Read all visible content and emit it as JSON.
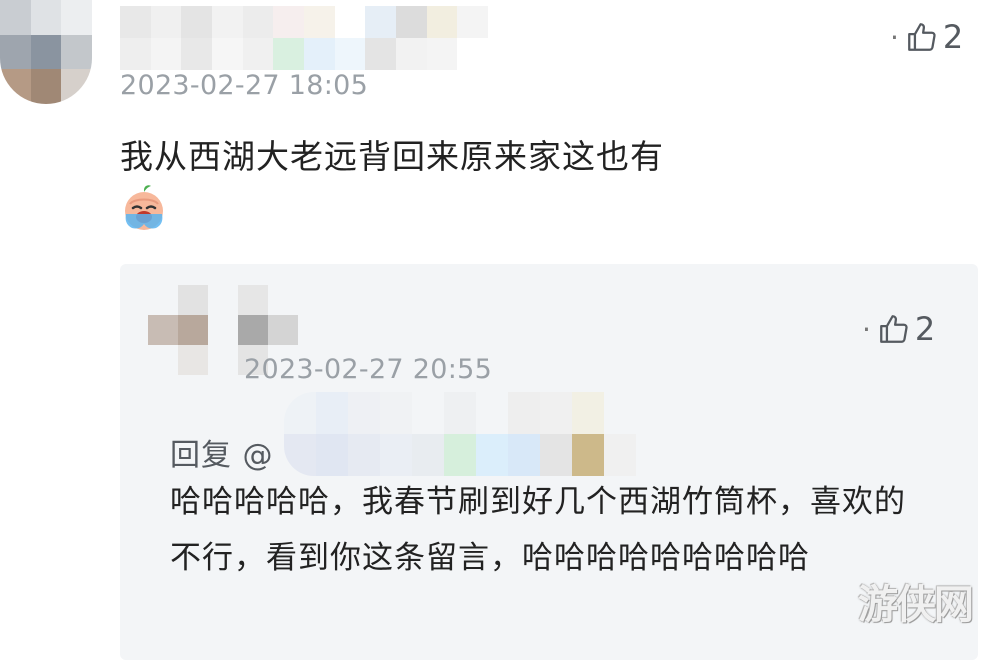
{
  "comment": {
    "timestamp": "2023-02-27 18:05",
    "text": "我从西湖大老远背回来原来家这也有",
    "emoji_icon": "crying-face-emoji-icon",
    "like_count": "2",
    "avatar_colors": [
      "#c9cdd2",
      "#dfe2e5",
      "#eceef0",
      "#9ea5ae",
      "#8a94a0",
      "#c3c7cb",
      "#b59a85",
      "#a08875",
      "#d6d0cb"
    ],
    "name_colors": [
      "#e8e8e8",
      "#f0f0f0",
      "#e4e4e4",
      "#f2f2f2",
      "#ececec",
      "#f6eeee",
      "#f6f2ea",
      "#ffffff",
      "#e6eef6",
      "#dcdcdc",
      "#f2eee0",
      "#f4f4f4",
      "#eeeeee",
      "#f4f4f4",
      "#e8e8e8",
      "#f6f6f6",
      "#f0f0f0",
      "#d9f0e0",
      "#e4f0fa",
      "#eef6fc",
      "#e4e4e4",
      "#f2f2f2",
      "#f4f4f4",
      "#ffffff"
    ]
  },
  "reply": {
    "timestamp": "2023-02-27 20:55",
    "reply_label": "回复 @",
    "text": "哈哈哈哈哈，我春节刷到好几个西湖竹筒杯，喜欢的不行，看到你这条留言，哈哈哈哈哈哈哈哈哈",
    "like_count": "2",
    "avatar_colors": [
      "#f3f5f7",
      "#e2e2e2",
      "#f3f5f7",
      "#e6e6e6",
      "#f3f5f7",
      "#c8bcb4",
      "#b8a89c",
      "#f3f5f7",
      "#a9a9a9",
      "#d4d4d4",
      "#f3f5f7",
      "#e8e6e4",
      "#f3f5f7",
      "#e4e4e4",
      "#f3f5f7"
    ],
    "name_colors": [
      "#eef2f6",
      "#e8eef6",
      "#eef0f4",
      "#f0f2f4",
      "#f3f5f7",
      "#eef0f2",
      "#f3f5f7",
      "#eeeeee",
      "#f0f0f0",
      "#f2f0e4",
      "#f3f5f7",
      "#e4e8f2",
      "#e0e6f2",
      "#e6eaf2",
      "#eaeef4",
      "#e8ecf0",
      "#d6efdc",
      "#dbeefb",
      "#d8e8f8",
      "#e4e4e4",
      "#cdb98a",
      "#f0f0f0"
    ]
  },
  "watermark": "游侠网",
  "colors": {
    "background": "#ffffff",
    "reply_background": "#f3f5f7",
    "timestamp": "#9aa0a6",
    "text": "#222222"
  }
}
